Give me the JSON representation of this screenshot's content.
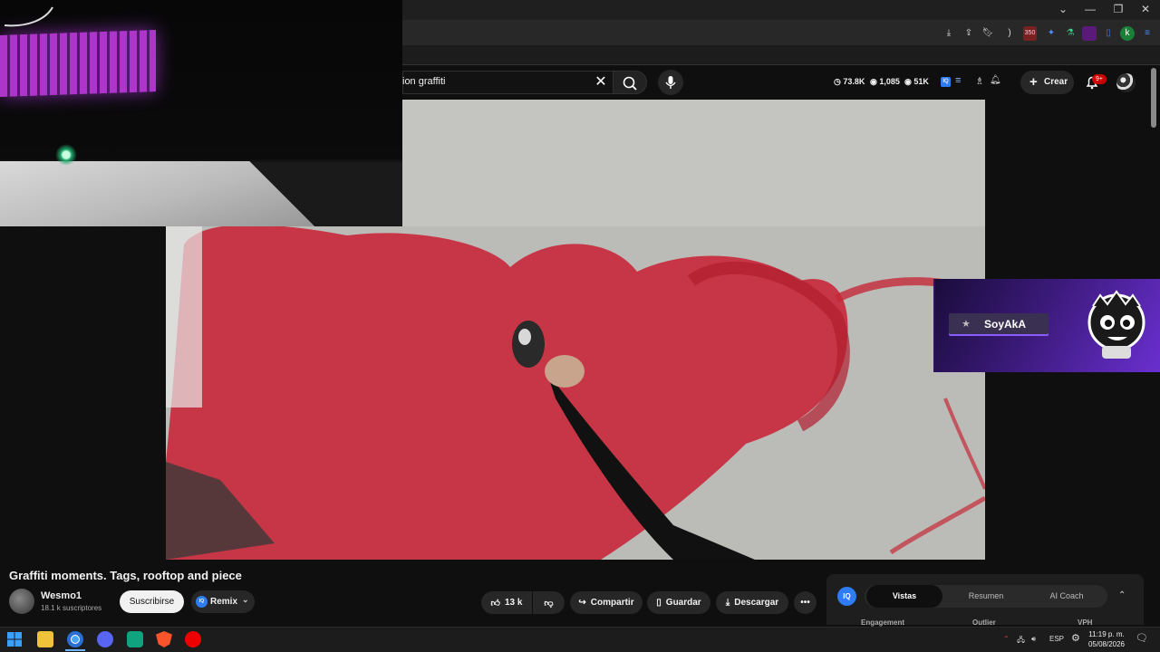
{
  "browser": {
    "window_controls": [
      "⌄",
      "—",
      "❐",
      "✕"
    ],
    "profile_initial": "k",
    "extension_badge": "350"
  },
  "youtube": {
    "search_value": "ion graffiti",
    "stats": {
      "watch_hours": "73.8K",
      "views": "1,085",
      "subs": "51K"
    },
    "create_label": "Crear",
    "notification_count": "9+"
  },
  "stream_alert": {
    "name": "SoyAkA"
  },
  "video": {
    "title": "Graffiti moments. Tags, rooftop and piece",
    "channel_name": "Wesmo1",
    "subscriber_count": "18.1 k suscriptores",
    "subscribe_label": "Suscribirse",
    "remix_label": "Remix",
    "likes": "13 k",
    "share_label": "Compartir",
    "save_label": "Guardar",
    "download_label": "Descargar"
  },
  "side_panel": {
    "iq_label": "IQ",
    "tabs": [
      "Vistas",
      "Resumen",
      "AI Coach"
    ],
    "active_tab": "Vistas",
    "columns": [
      "Engagement",
      "Outlier",
      "VPH"
    ]
  },
  "taskbar": {
    "language": "ESP",
    "time": "11:19 p. m.",
    "date": "05/08/2026"
  }
}
